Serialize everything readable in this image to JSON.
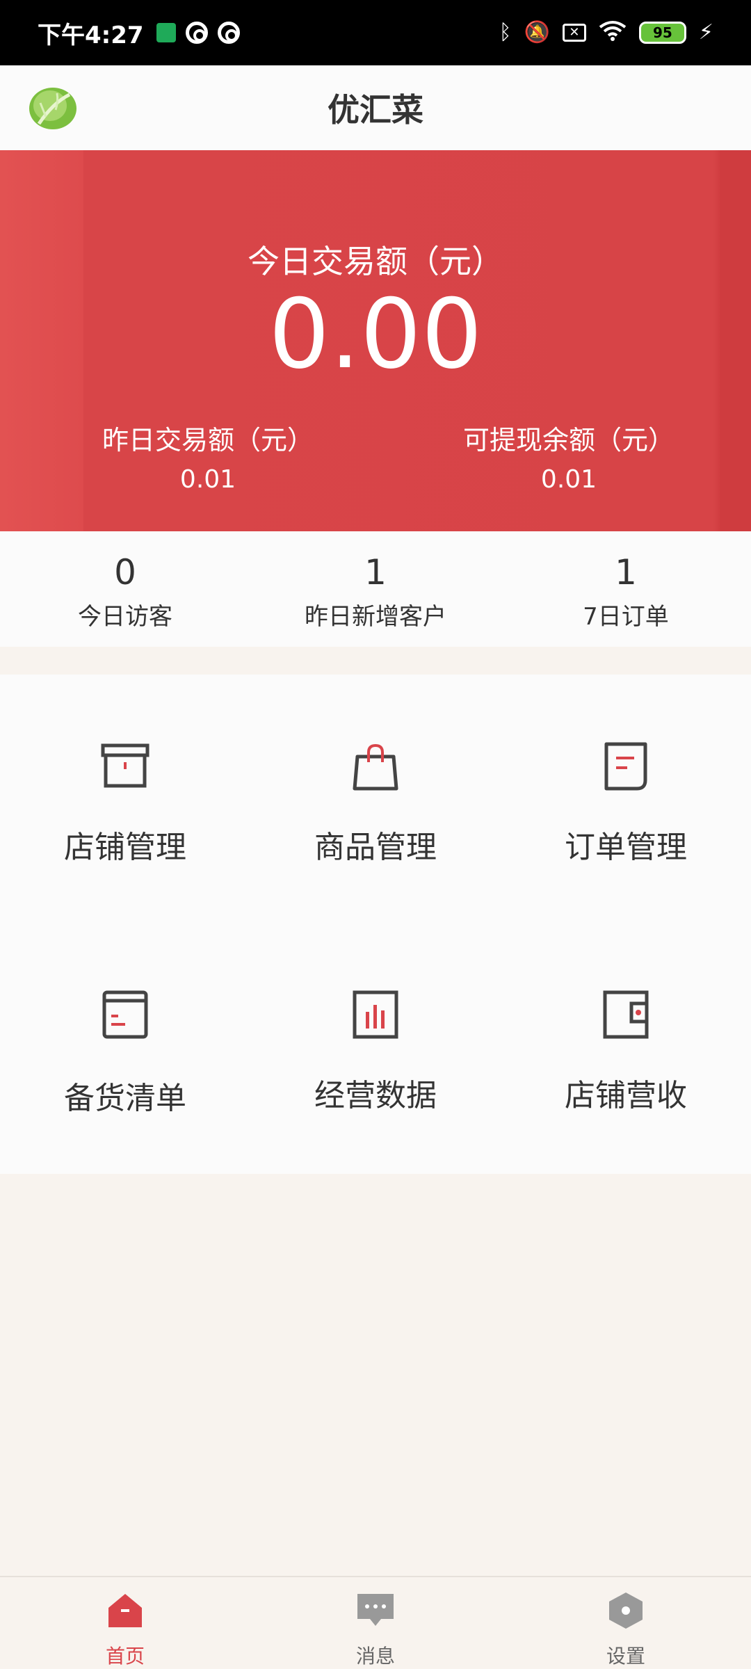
{
  "status_bar": {
    "time": "下午4:27",
    "battery": "95"
  },
  "header": {
    "title": "优汇菜"
  },
  "banner": {
    "today_label": "今日交易额（元）",
    "today_amount": "0.00",
    "yesterday_label": "昨日交易额（元）",
    "yesterday_value": "0.01",
    "withdrawable_label": "可提现余额（元）",
    "withdrawable_value": "0.01"
  },
  "stats": [
    {
      "value": "0",
      "label": "今日访客"
    },
    {
      "value": "1",
      "label": "昨日新增客户"
    },
    {
      "value": "1",
      "label": "7日订单"
    }
  ],
  "grid": [
    {
      "label": "店铺管理",
      "icon": "store-box-icon"
    },
    {
      "label": "商品管理",
      "icon": "shopping-bag-icon"
    },
    {
      "label": "订单管理",
      "icon": "order-document-icon"
    },
    {
      "label": "备货清单",
      "icon": "stock-list-icon"
    },
    {
      "label": "经营数据",
      "icon": "bar-chart-icon"
    },
    {
      "label": "店铺营收",
      "icon": "wallet-icon"
    }
  ],
  "bottom_nav": [
    {
      "label": "首页",
      "icon": "home-icon",
      "active": true
    },
    {
      "label": "消息",
      "icon": "message-icon",
      "active": false
    },
    {
      "label": "设置",
      "icon": "settings-icon",
      "active": false
    }
  ],
  "colors": {
    "accent": "#d9444a",
    "banner": "#d74447",
    "icon_dark": "#444444"
  }
}
